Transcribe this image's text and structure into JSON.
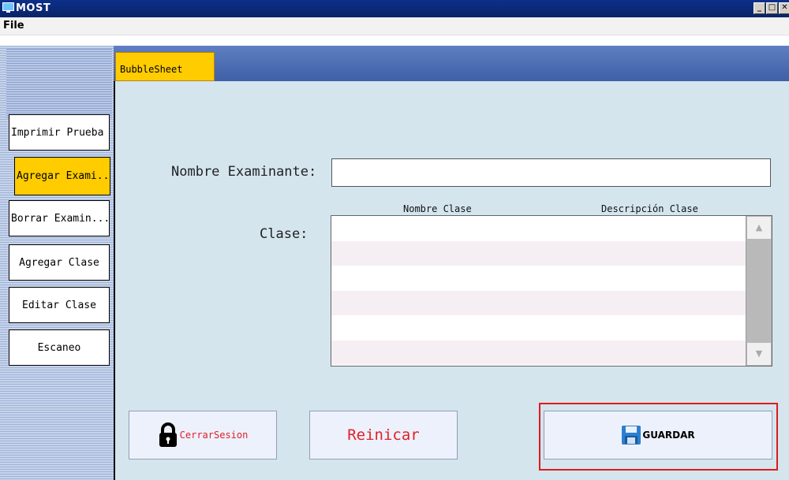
{
  "window": {
    "title": "MOST",
    "controls": [
      "_",
      "□",
      "✕"
    ]
  },
  "menu": {
    "file": "File"
  },
  "tab": {
    "label": "BubbleSheet"
  },
  "sidebar": {
    "items": [
      {
        "label": "Imprimir Prueba",
        "active": false
      },
      {
        "label": "Agregar Exami...",
        "active": true
      },
      {
        "label": "Borrar Examin...",
        "active": false
      },
      {
        "label": "Agregar Clase",
        "active": false
      },
      {
        "label": "Editar Clase",
        "active": false
      },
      {
        "label": "Escaneo",
        "active": false
      }
    ]
  },
  "form": {
    "name_label": "Nombre Examinante:",
    "name_value": "",
    "class_label": "Clase:",
    "table_headers": [
      "Nombre Clase",
      "Descripción Clase"
    ],
    "rows": 6
  },
  "buttons": {
    "logout": "CerrarSesion",
    "reset": "Reinicar",
    "save": "GUARDAR"
  },
  "colors": {
    "accent": "#ffcc00",
    "content_bg": "#d4e5ee",
    "highlight": "#e01b1b",
    "red_text": "#e0202a"
  },
  "icons": {
    "logout": "lock-icon",
    "save": "floppy-disk-icon",
    "app": "monitor-icon"
  }
}
